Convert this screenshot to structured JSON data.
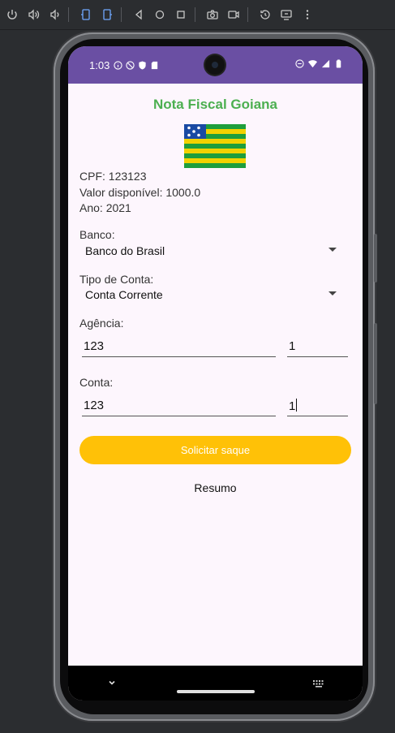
{
  "app": {
    "title": "Nota Fiscal Goiana",
    "info": {
      "cpf": "CPF: 123123",
      "valor": "Valor disponível: 1000.0",
      "ano": "Ano: 2021"
    },
    "banco": {
      "label": "Banco:",
      "value": "Banco do Brasil"
    },
    "tipo_conta": {
      "label": "Tipo de Conta:",
      "value": "Conta Corrente"
    },
    "agencia": {
      "label": "Agência:",
      "value": "123",
      "digit": "1"
    },
    "conta": {
      "label": "Conta:",
      "value": "123",
      "digit": "1"
    },
    "submit_label": "Solicitar saque",
    "summary_label": "Resumo"
  },
  "status_bar": {
    "time": "1:03"
  },
  "colors": {
    "accent": "#4caf50",
    "status_bar": "#6a4fa3",
    "button": "#ffc107",
    "background": "#fdf6fd"
  }
}
